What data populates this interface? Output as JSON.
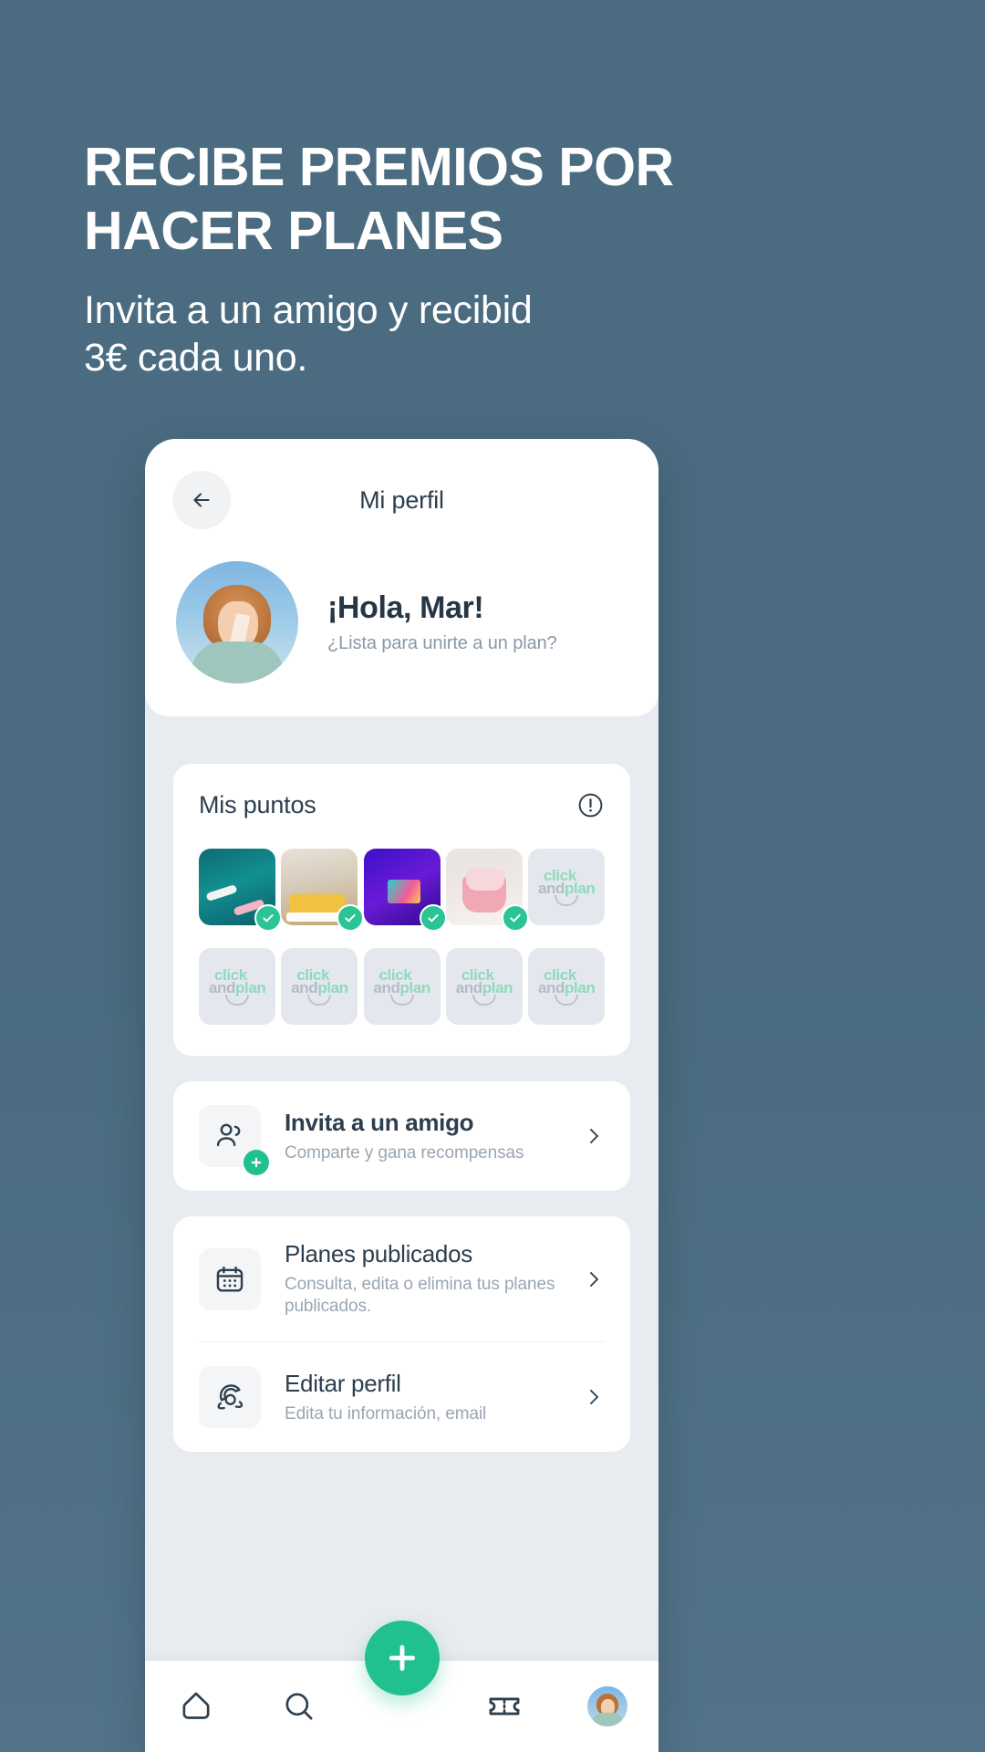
{
  "promo": {
    "title_line1": "RECIBE PREMIOS POR",
    "title_line2": "HACER PLANES",
    "subtitle_line1": "Invita  a un amigo y recibid",
    "subtitle_line2": "3€ cada uno."
  },
  "colors": {
    "background": "#4a6b80",
    "accent_green": "#21c08f",
    "logo_green": "#8fd9bd",
    "text_dark": "#2d3e4e",
    "text_muted": "#9aa6b2",
    "card": "#ffffff",
    "app_background": "#e8ebf0"
  },
  "header": {
    "title": "Mi perfil",
    "back_icon": "arrow-left-icon"
  },
  "profile": {
    "greeting": "¡Hola, Mar!",
    "prompt": "¿Lista para unirte a un plan?",
    "avatar_alt": "avatar"
  },
  "points": {
    "title": "Mis puntos",
    "info_icon": "info-circle-icon",
    "logo": {
      "click": "click",
      "and": "and",
      "plan": "plan"
    },
    "stamps": [
      {
        "state": "earned",
        "image": "surf",
        "check_icon": "check-icon"
      },
      {
        "state": "earned",
        "image": "food",
        "check_icon": "check-icon"
      },
      {
        "state": "earned",
        "image": "neon",
        "check_icon": "check-icon"
      },
      {
        "state": "earned",
        "image": "mug",
        "check_icon": "check-icon"
      },
      {
        "state": "empty",
        "image": "placeholder"
      },
      {
        "state": "empty",
        "image": "placeholder"
      },
      {
        "state": "empty",
        "image": "placeholder"
      },
      {
        "state": "empty",
        "image": "placeholder"
      },
      {
        "state": "empty",
        "image": "placeholder"
      },
      {
        "state": "empty",
        "image": "placeholder"
      }
    ],
    "earned_count": 4,
    "total_count": 10
  },
  "invite_row": {
    "title": "Invita a un amigo",
    "subtitle": "Comparte y gana recompensas",
    "icon": "users-icon",
    "badge_icon": "plus-circle-icon",
    "chevron": "chevron-right-icon"
  },
  "menu_rows": [
    {
      "title": "Planes publicados",
      "subtitle": "Consulta, edita o elimina tus planes publicados.",
      "icon": "calendar-icon",
      "chevron": "chevron-right-icon"
    },
    {
      "title": "Editar perfil",
      "subtitle": "Edita tu información, email",
      "icon": "gear-icon",
      "chevron": "chevron-right-icon"
    }
  ],
  "bottom_nav": {
    "items": [
      {
        "name": "home",
        "icon": "home-icon"
      },
      {
        "name": "search",
        "icon": "search-icon"
      },
      {
        "name": "create",
        "icon": "plus-icon"
      },
      {
        "name": "tickets",
        "icon": "ticket-icon"
      },
      {
        "name": "profile",
        "icon": "avatar-icon"
      }
    ]
  }
}
